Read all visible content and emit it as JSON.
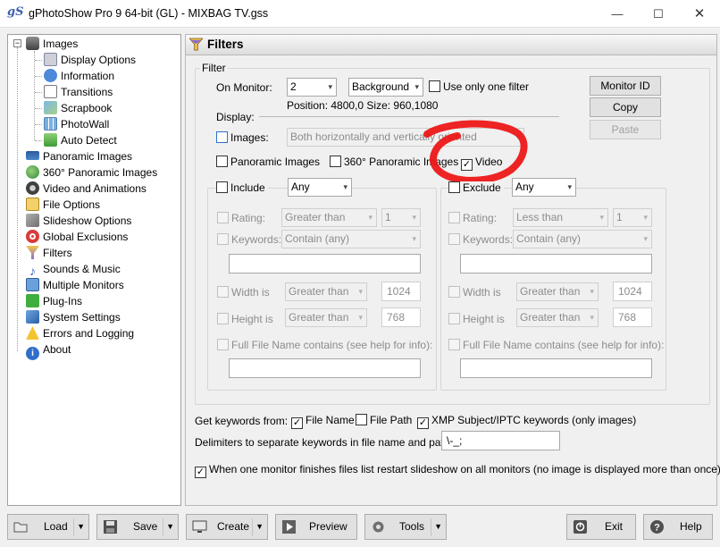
{
  "window": {
    "app_icon": "gS",
    "title": "gPhotoShow Pro 9 64-bit (GL) - MIXBAG TV.gss",
    "minimize": "—",
    "maximize": "☐",
    "close": "✕"
  },
  "tree": {
    "root": "Images",
    "children": [
      "Display Options",
      "Information",
      "Transitions",
      "Scrapbook",
      "PhotoWall",
      "Auto Detect"
    ],
    "items": [
      "Panoramic Images",
      "360° Panoramic Images",
      "Video and Animations",
      "File Options",
      "Slideshow Options",
      "Global Exclusions",
      "Filters",
      "Sounds & Music",
      "Multiple Monitors",
      "Plug-Ins",
      "System Settings",
      "Errors and Logging",
      "About"
    ],
    "selected": "Filters"
  },
  "panel": {
    "title": "Filters",
    "filter_group": "Filter",
    "on_monitor_label": "On Monitor:",
    "monitor_value": "2",
    "background_value": "Background",
    "use_only_one_filter": "Use only one filter",
    "monitor_id_button": "Monitor ID",
    "copy_button": "Copy",
    "paste_button": "Paste",
    "position_text": "Position: 4800,0  Size: 960,1080",
    "display_label": "Display:",
    "images_label": "Images:",
    "orientation_value": "Both horizontally and vertically oriented",
    "panoramic_images": "Panoramic Images",
    "panoramic_360": "360° Panoramic Images",
    "video": "Video",
    "include": {
      "label": "Include",
      "mode": "Any",
      "rating_label": "Rating:",
      "rating_op": "Greater than",
      "rating_value": "1",
      "keywords_label": "Keywords:",
      "keywords_op": "Contain (any)",
      "width_label": "Width is",
      "width_op": "Greater than",
      "width_value": "1024",
      "height_label": "Height is",
      "height_op": "Greater than",
      "height_value": "768",
      "fullname_label": "Full File Name contains (see help for info):"
    },
    "exclude": {
      "label": "Exclude",
      "mode": "Any",
      "rating_label": "Rating:",
      "rating_op": "Less than",
      "rating_value": "1",
      "keywords_label": "Keywords:",
      "keywords_op": "Contain (any)",
      "width_label": "Width is",
      "width_op": "Greater than",
      "width_value": "1024",
      "height_label": "Height is",
      "height_op": "Greater than",
      "height_value": "768",
      "fullname_label": "Full File Name contains (see help for info):"
    },
    "get_keywords_from": "Get keywords from:",
    "file_name": "File Name",
    "file_path": "File Path",
    "xmp_subject": "XMP Subject/IPTC keywords (only images)",
    "delimiters_label": "Delimiters to separate keywords in file name and path:",
    "delimiters_value": "\\-_;",
    "restart_text": "When one monitor finishes files list restart slideshow on all monitors (no image is displayed more than once)"
  },
  "toolbar": {
    "load": "Load",
    "save": "Save",
    "create": "Create",
    "preview": "Preview",
    "tools": "Tools",
    "exit": "Exit",
    "help": "Help"
  },
  "colors": {
    "annotation": "#ee1111",
    "accent": "#2f6fc9"
  }
}
